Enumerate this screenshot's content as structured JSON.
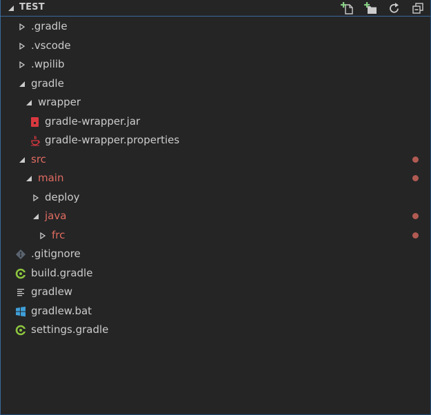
{
  "header": {
    "title": "TEST",
    "actions": [
      {
        "name": "new-file",
        "icon": "new-file-icon"
      },
      {
        "name": "new-folder",
        "icon": "new-folder-icon"
      },
      {
        "name": "refresh",
        "icon": "refresh-icon"
      },
      {
        "name": "collapse-all",
        "icon": "collapse-all-icon"
      }
    ]
  },
  "colors": {
    "background": "#252526",
    "text": "#cccccc",
    "modified": "#e06c60",
    "modified_dot": "#b05a52",
    "accent_green": "#89d185",
    "gradle_green": "#8dc63f",
    "jar_red": "#d9383f",
    "windows_blue": "#3f9fd8"
  },
  "tree": [
    {
      "label": ".gradle",
      "type": "folder",
      "expanded": false,
      "depth": 0,
      "modified": false
    },
    {
      "label": ".vscode",
      "type": "folder",
      "expanded": false,
      "depth": 0,
      "modified": false
    },
    {
      "label": ".wpilib",
      "type": "folder",
      "expanded": false,
      "depth": 0,
      "modified": false
    },
    {
      "label": "gradle",
      "type": "folder",
      "expanded": true,
      "depth": 0,
      "modified": false
    },
    {
      "label": "wrapper",
      "type": "folder",
      "expanded": true,
      "depth": 1,
      "modified": false
    },
    {
      "label": "gradle-wrapper.jar",
      "type": "file",
      "icon": "jar-file-icon",
      "depth": 2,
      "modified": false
    },
    {
      "label": "gradle-wrapper.properties",
      "type": "file",
      "icon": "java-properties-icon",
      "depth": 2,
      "modified": false
    },
    {
      "label": "src",
      "type": "folder",
      "expanded": true,
      "depth": 0,
      "modified": true
    },
    {
      "label": "main",
      "type": "folder",
      "expanded": true,
      "depth": 1,
      "modified": true
    },
    {
      "label": "deploy",
      "type": "folder",
      "expanded": false,
      "depth": 2,
      "modified": false
    },
    {
      "label": "java",
      "type": "folder",
      "expanded": true,
      "depth": 2,
      "modified": true
    },
    {
      "label": "frc",
      "type": "folder",
      "expanded": false,
      "depth": 3,
      "modified": true
    },
    {
      "label": ".gitignore",
      "type": "file",
      "icon": "git-file-icon",
      "depth": 0,
      "modified": false
    },
    {
      "label": "build.gradle",
      "type": "file",
      "icon": "gradle-file-icon",
      "depth": 0,
      "modified": false
    },
    {
      "label": "gradlew",
      "type": "file",
      "icon": "text-lines-file-icon",
      "depth": 0,
      "modified": false
    },
    {
      "label": "gradlew.bat",
      "type": "file",
      "icon": "windows-file-icon",
      "depth": 0,
      "modified": false
    },
    {
      "label": "settings.gradle",
      "type": "file",
      "icon": "gradle-file-icon",
      "depth": 0,
      "modified": false
    }
  ]
}
